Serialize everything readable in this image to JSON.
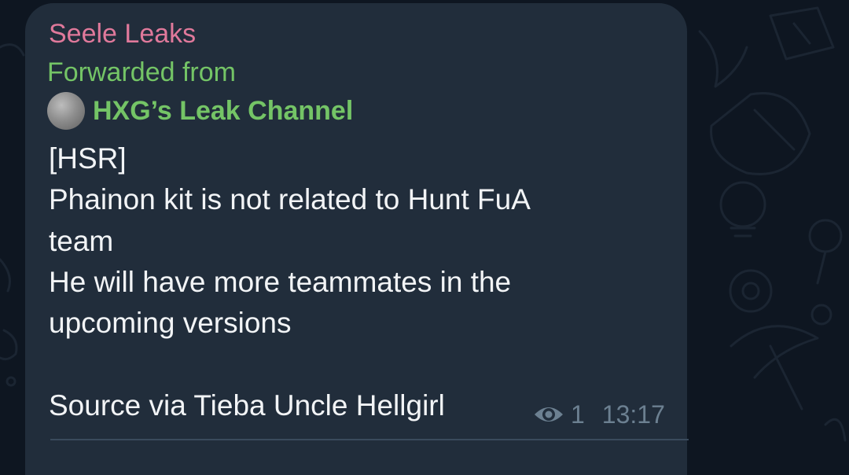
{
  "message": {
    "sender": "Seele Leaks",
    "forwarded_label": "Forwarded from",
    "forwarded_channel": "HXG’s Leak Channel",
    "text": "[HSR]\nPhainon kit is not related to Hunt FuA\nteam\nHe will have more teammates in the\nupcoming versions\n\nSource via Tieba Uncle Hellgirl",
    "views": "1",
    "time": "13:17"
  },
  "colors": {
    "background": "#0e1621",
    "bubble": "#212d3b",
    "sender_name": "#e0799b",
    "forward_green": "#74c466",
    "text": "#f2f4f6",
    "meta": "#6c8091"
  },
  "icons": {
    "views": "eye-icon",
    "forward_avatar": "channel-avatar"
  }
}
